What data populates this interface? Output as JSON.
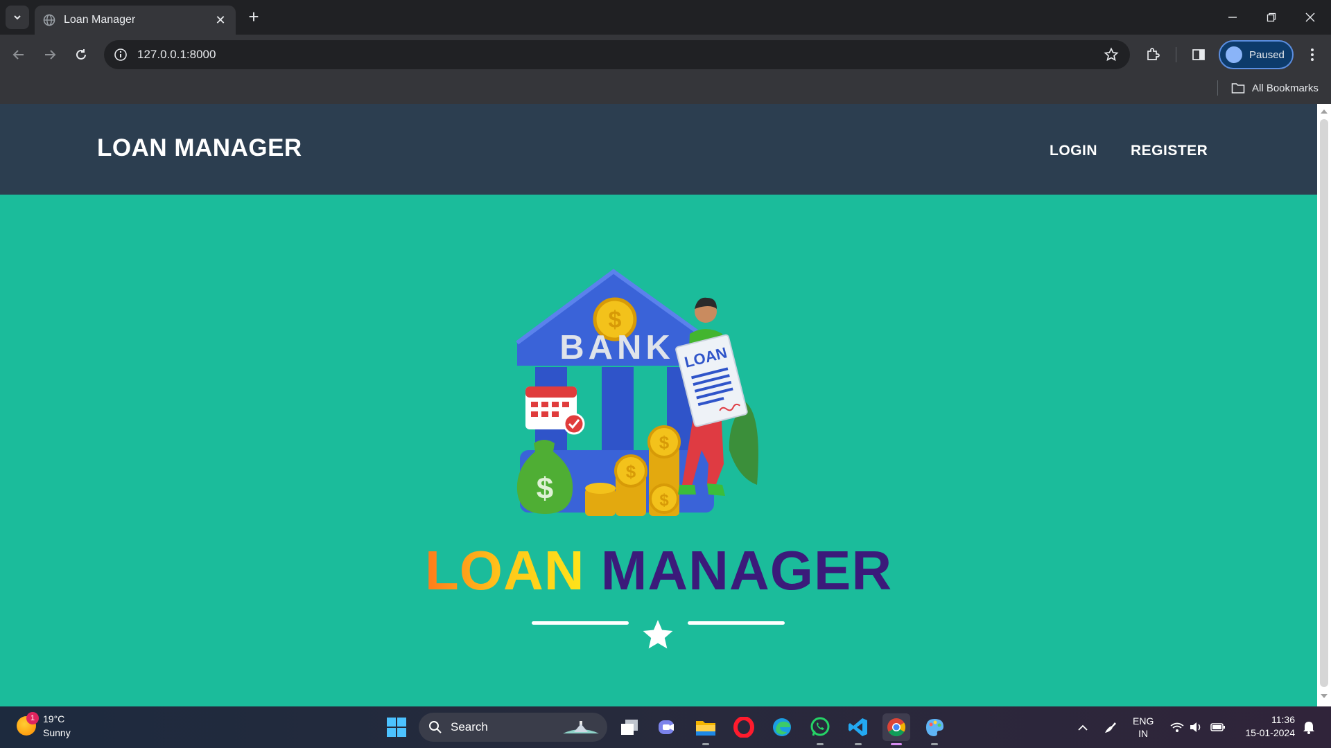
{
  "browser": {
    "tab_title": "Loan Manager",
    "url": "127.0.0.1:8000",
    "profile_label": "Paused",
    "bookmarks_label": "All Bookmarks"
  },
  "navbar": {
    "brand": "LOAN MANAGER",
    "links": [
      "LOGIN",
      "REGISTER"
    ]
  },
  "hero": {
    "illustration_sign": "BANK",
    "illustration_paper": "LOAN",
    "title_word_1": "LOAN",
    "title_word_2": "MANAGER"
  },
  "taskbar": {
    "weather_temp": "19°C",
    "weather_desc": "Sunny",
    "weather_badge": "1",
    "search_label": "Search",
    "lang_line1": "ENG",
    "lang_line2": "IN",
    "time": "11:36",
    "date": "15-01-2024"
  },
  "colors": {
    "navbar_bg": "#2c3e50",
    "page_bg": "#1bbc9b",
    "title_word_2": "#3b1a7a"
  }
}
